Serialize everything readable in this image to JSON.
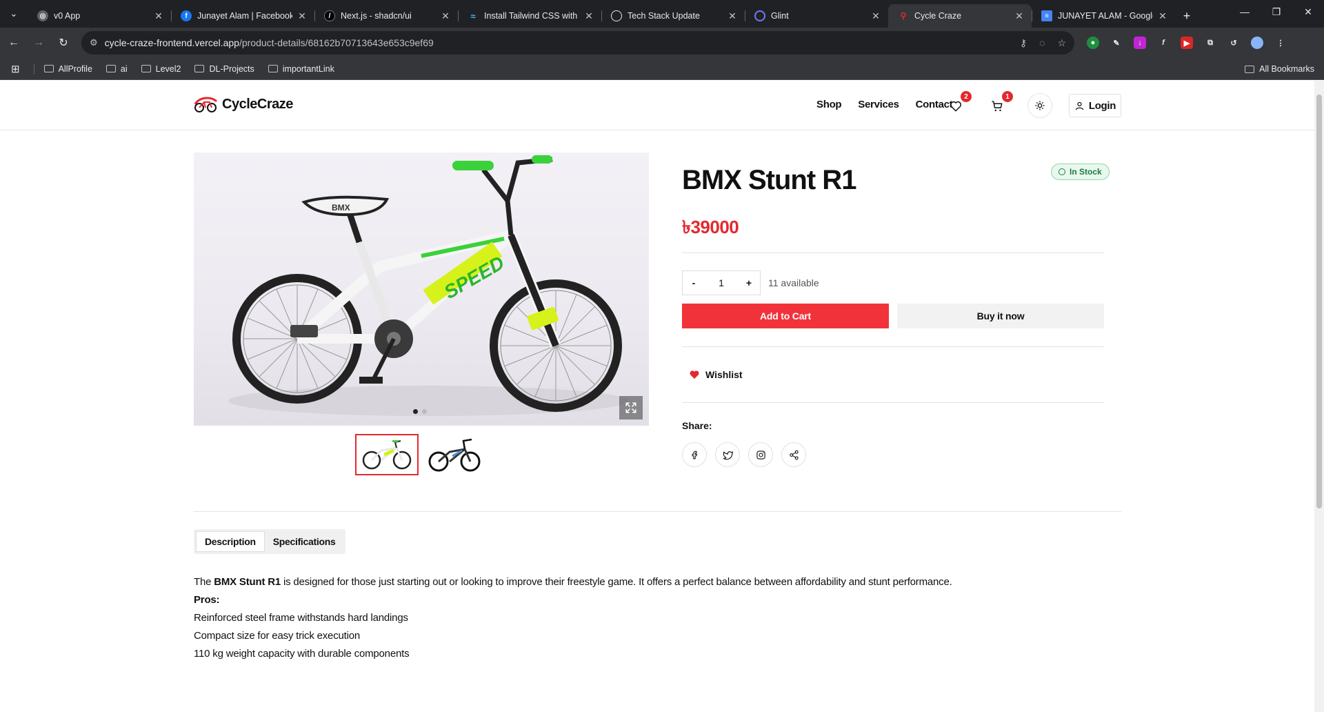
{
  "browser": {
    "tabs": [
      {
        "title": "v0 App",
        "icon": "globe-icon",
        "active": false
      },
      {
        "title": "Junayet Alam | Facebook",
        "icon": "facebook-icon",
        "active": false
      },
      {
        "title": "Next.js - shadcn/ui",
        "icon": "shadcn-icon",
        "active": false
      },
      {
        "title": "Install Tailwind CSS with N",
        "icon": "tailwind-icon",
        "active": false
      },
      {
        "title": "Tech Stack Update",
        "icon": "chatgpt-icon",
        "active": false
      },
      {
        "title": "Glint",
        "icon": "glint-icon",
        "active": false
      },
      {
        "title": "Cycle Craze",
        "icon": "cyclecraze-icon",
        "active": true
      },
      {
        "title": "JUNAYET ALAM - Google",
        "icon": "google-docs-icon",
        "active": false
      }
    ],
    "url_host": "cycle-craze-frontend.vercel.app",
    "url_path": "/product-details/68162b70713643e653c9ef69",
    "bookmarks": [
      "AllProfile",
      "ai",
      "Level2",
      "DL-Projects",
      "importantLink"
    ],
    "all_bookmarks": "All Bookmarks"
  },
  "site": {
    "brand": "CycleCraze",
    "nav": [
      "Shop",
      "Services",
      "Contact"
    ],
    "wishlist_count": "2",
    "cart_count": "1",
    "login_label": "Login"
  },
  "product": {
    "title": "BMX Stunt R1",
    "stock": "In Stock",
    "price": "৳39000",
    "qty_minus": "-",
    "qty_value": "1",
    "qty_plus": "+",
    "available": "11 available",
    "add_to_cart": "Add to Cart",
    "buy_now": "Buy it now",
    "wishlist": "Wishlist",
    "share_label": "Share:",
    "share_icons": [
      "facebook-icon",
      "twitter-icon",
      "instagram-icon",
      "share-icon"
    ],
    "slides": 2,
    "active_slide": 1
  },
  "details": {
    "tabs": [
      "Description",
      "Specifications"
    ],
    "active_tab": "Description",
    "desc_lead": "The ",
    "desc_bold": "BMX Stunt R1",
    "desc_rest": " is designed for those just starting out or looking to improve their freestyle game. It offers a perfect balance between affordability and stunt performance.",
    "pros_heading": "Pros:",
    "pros": [
      "Reinforced steel frame withstands hard landings",
      "Compact size for easy trick execution",
      "110 kg weight capacity with durable components"
    ]
  },
  "colors": {
    "accent": "#f2323a",
    "stock_green": "#1e7b3f",
    "chrome_dark": "#202124",
    "chrome_mid": "#35363a"
  }
}
